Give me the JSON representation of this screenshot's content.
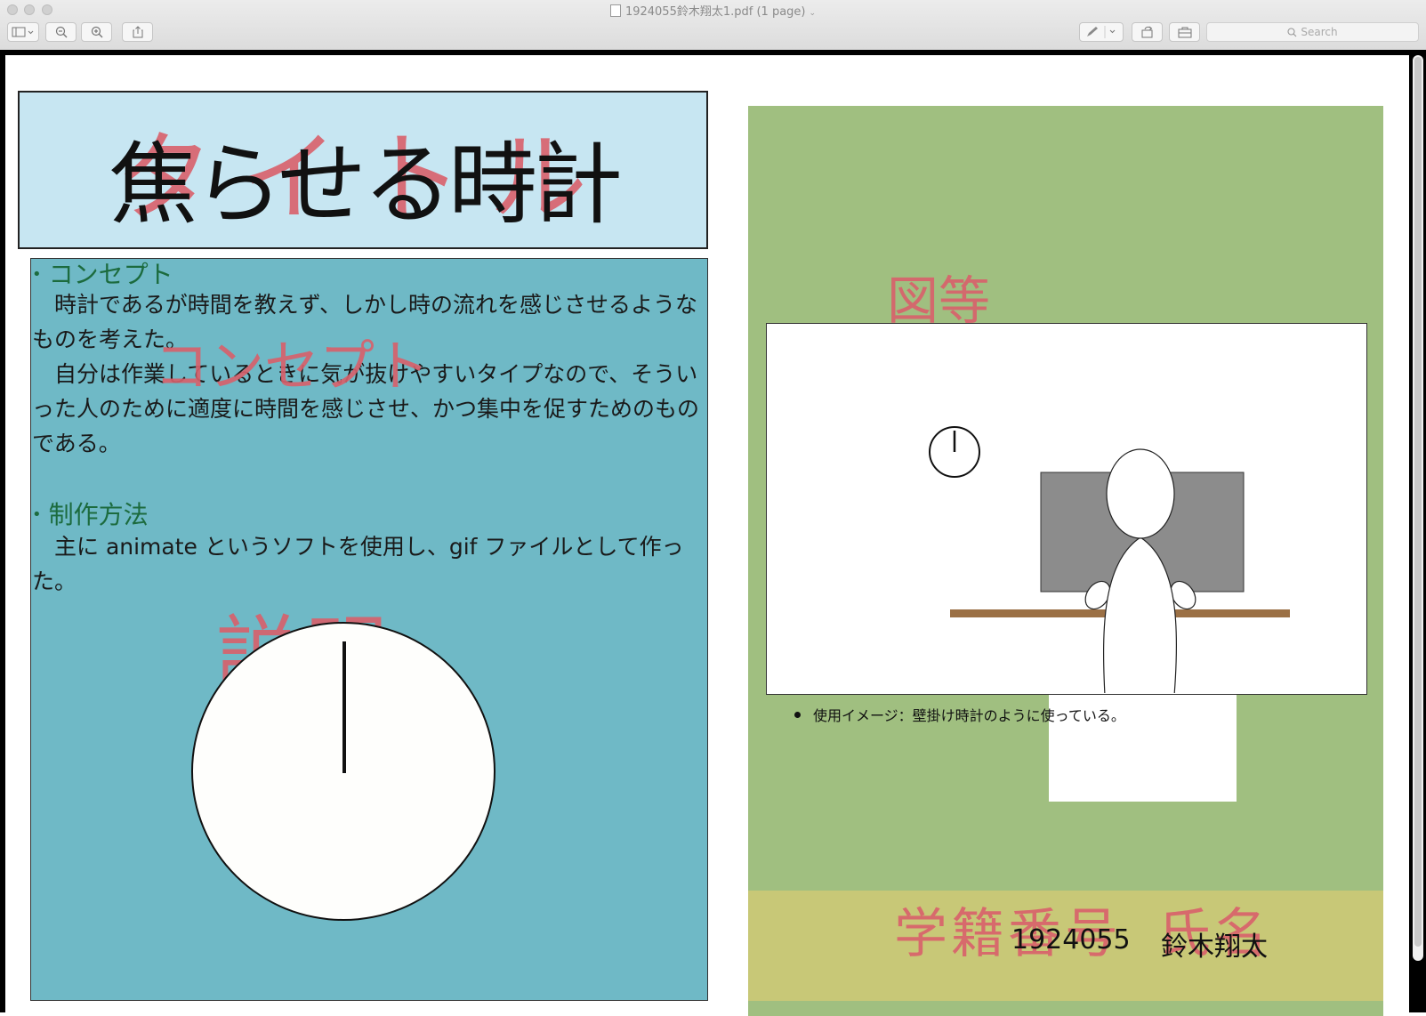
{
  "window": {
    "title": "1924055鈴木翔太1.pdf (1 page)",
    "search_placeholder": "Search"
  },
  "poster": {
    "title_placeholder": "タイトル",
    "title": "焦らせる時計",
    "concept_placeholder": "コンセプト",
    "description_placeholder": "説明",
    "concept_heading": "コンセプト",
    "concept_paragraph_1": "　時計であるが時間を教えず、しかし時の流れを感じさせるようなものを考えた。",
    "concept_paragraph_2": "　自分は作業しているときに気が抜けやすいタイプなので、そういった人のために適度に時間を感じさせ、かつ集中を促すためのものである。",
    "method_heading": "制作方法",
    "method_paragraph": "　主に animate というソフトを使用し、gif ファイルとして作った。",
    "figure_placeholder": "図等",
    "figure_caption": "使用イメージ：壁掛け時計のように使っている。",
    "student_id_placeholder": "学籍番号",
    "name_placeholder": "氏名",
    "student_id": "1924055",
    "name": "鈴木翔太"
  },
  "icons": [
    "sidebar-toggle-icon",
    "zoom-out-icon",
    "zoom-in-icon",
    "share-icon",
    "markup-pen-icon",
    "rotate-icon",
    "toolbox-icon",
    "search-icon",
    "file-icon"
  ]
}
